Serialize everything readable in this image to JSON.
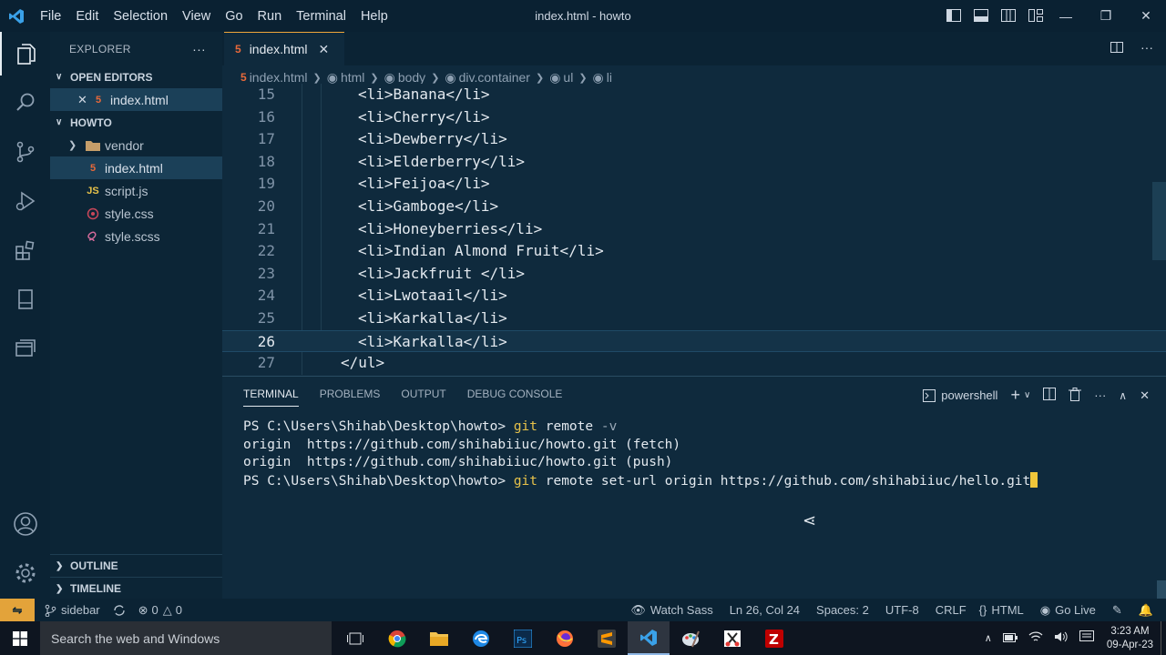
{
  "window": {
    "title": "index.html - howto",
    "menu": [
      "File",
      "Edit",
      "Selection",
      "View",
      "Go",
      "Run",
      "Terminal",
      "Help"
    ]
  },
  "sidebar": {
    "header": "EXPLORER",
    "open_editors_label": "OPEN EDITORS",
    "open_editors": [
      {
        "name": "index.html",
        "icon": "html5-icon"
      }
    ],
    "project_label": "HOWTO",
    "files": [
      {
        "name": "vendor",
        "type": "folder",
        "icon": "folder-icon"
      },
      {
        "name": "index.html",
        "type": "file",
        "icon": "html5-icon"
      },
      {
        "name": "script.js",
        "type": "file",
        "icon": "js-icon"
      },
      {
        "name": "style.css",
        "type": "file",
        "icon": "css-icon"
      },
      {
        "name": "style.scss",
        "type": "file",
        "icon": "sass-icon"
      }
    ],
    "outline_label": "OUTLINE",
    "timeline_label": "TIMELINE"
  },
  "editor": {
    "tab_label": "index.html",
    "breadcrumb": [
      "index.html",
      "html",
      "body",
      "div.container",
      "ul",
      "li"
    ],
    "lines": [
      {
        "num": "15",
        "text": "<li>Banana</li>"
      },
      {
        "num": "16",
        "text": "<li>Cherry</li>"
      },
      {
        "num": "17",
        "text": "<li>Dewberry</li>"
      },
      {
        "num": "18",
        "text": "<li>Elderberry</li>"
      },
      {
        "num": "19",
        "text": "<li>Feijoa</li>"
      },
      {
        "num": "20",
        "text": "<li>Gamboge</li>"
      },
      {
        "num": "21",
        "text": "<li>Honeyberries</li>"
      },
      {
        "num": "22",
        "text": "<li>Indian Almond Fruit</li>"
      },
      {
        "num": "23",
        "text": "<li>Jackfruit </li>"
      },
      {
        "num": "24",
        "text": "<li>Lwotaail</li>"
      },
      {
        "num": "25",
        "text": "<li>Karkalla</li>"
      },
      {
        "num": "26",
        "text": "<li>Karkalla</li>"
      },
      {
        "num": "27",
        "text": "</ul>"
      }
    ],
    "current_line": "26"
  },
  "panel": {
    "tabs": [
      "TERMINAL",
      "PROBLEMS",
      "OUTPUT",
      "DEBUG CONSOLE"
    ],
    "active_tab": "TERMINAL",
    "shell": "powershell",
    "terminal": [
      {
        "prompt": "PS C:\\Users\\Shihab\\Desktop\\howto> ",
        "cmd": "git",
        "args": " remote ",
        "flag": "-v",
        "rest": ""
      },
      {
        "plain": "origin  https://github.com/shihabiiuc/howto.git (fetch)"
      },
      {
        "plain": "origin  https://github.com/shihabiiuc/howto.git (push)"
      },
      {
        "prompt": "PS C:\\Users\\Shihab\\Desktop\\howto> ",
        "cmd": "git",
        "args": " remote set-url origin https://github.com/shihabiiuc/hello.git",
        "flag": "",
        "rest": ""
      }
    ]
  },
  "status": {
    "branch": "sidebar",
    "errors": "0",
    "warnings": "0",
    "watch_sass": "Watch Sass",
    "position": "Ln 26, Col 24",
    "spaces": "Spaces: 2",
    "encoding": "UTF-8",
    "eol": "CRLF",
    "language": "HTML",
    "go_live": "Go Live"
  },
  "taskbar": {
    "search_placeholder": "Search the web and Windows",
    "time": "3:23 AM",
    "date": "09-Apr-23"
  },
  "colors": {
    "accent": "#f0a63a",
    "background": "#0f2a3d",
    "terminal_command": "#e7c24a"
  }
}
